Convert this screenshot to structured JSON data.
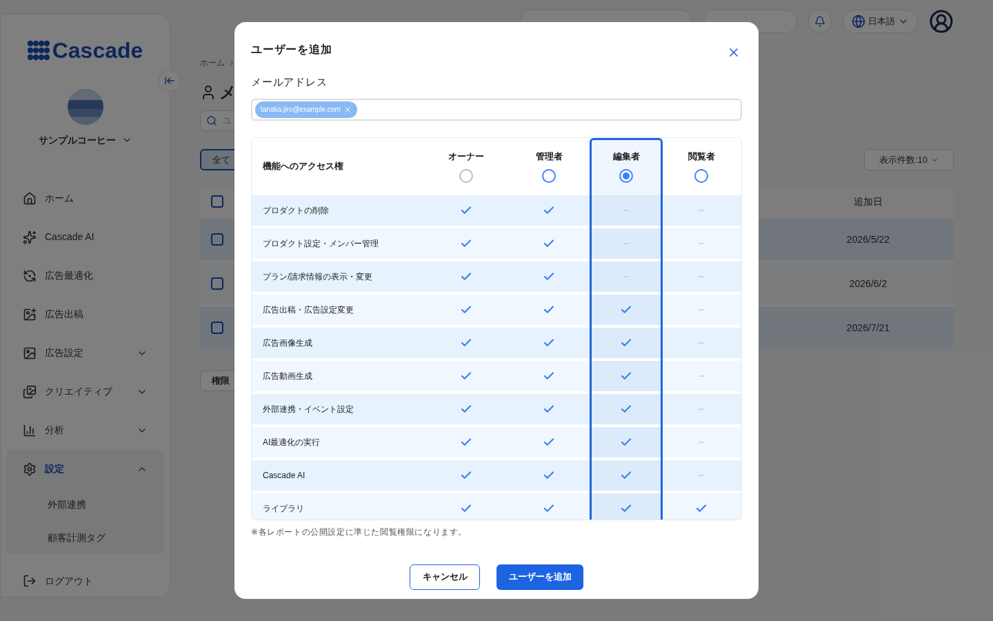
{
  "sidebar": {
    "logo": "Cascade",
    "company": "サンプルコーヒー",
    "items": [
      {
        "label": "ホーム",
        "kind": "link",
        "selected": false
      },
      {
        "label": "Cascade AI",
        "kind": "link",
        "selected": false
      },
      {
        "label": "広告最適化",
        "kind": "link",
        "selected": false
      },
      {
        "label": "広告出稿",
        "kind": "link",
        "selected": false
      },
      {
        "label": "広告設定",
        "kind": "group",
        "expanded": false,
        "selected": false
      },
      {
        "label": "クリエイティブ",
        "kind": "group",
        "expanded": false,
        "selected": false
      },
      {
        "label": "分析",
        "kind": "group",
        "expanded": false,
        "selected": false
      },
      {
        "label": "設定",
        "kind": "group",
        "expanded": true,
        "selected": true,
        "children": [
          {
            "label": "外部連携"
          },
          {
            "label": "顧客計測タグ"
          }
        ]
      }
    ],
    "logout": "ログアウト"
  },
  "topbar": {
    "language": "日本語"
  },
  "page": {
    "breadcrumb": "ホーム",
    "title_fragment": "メ",
    "search_fragment": "ユ",
    "filter_fragment": "全て",
    "page_size": "表示件数:10",
    "header_checked": false,
    "date_header": "追加日",
    "rows": [
      {
        "date": "2026/5/22",
        "checked": false
      },
      {
        "date": "2026/6/2",
        "checked": false
      },
      {
        "date": "2026/7/21",
        "checked": false
      }
    ],
    "permission_fragment": "権限"
  },
  "dialog": {
    "title": "ユーザーを追加",
    "email_label": "メールアドレス",
    "emails": [
      "tanaka.jiro@example.com"
    ],
    "access_header": "機能へのアクセス権",
    "roles": [
      {
        "label": "オーナー",
        "selected": false,
        "disabled": true
      },
      {
        "label": "管理者",
        "selected": false,
        "disabled": false
      },
      {
        "label": "編集者",
        "selected": true,
        "disabled": false
      },
      {
        "label": "閲覧者",
        "selected": false,
        "disabled": false
      }
    ],
    "features": [
      {
        "label": "プロダクトの削除",
        "access": [
          true,
          true,
          false,
          false
        ]
      },
      {
        "label": "プロダクト設定・メンバー管理",
        "access": [
          true,
          true,
          false,
          false
        ]
      },
      {
        "label": "プラン/請求情報の表示・変更",
        "access": [
          true,
          true,
          false,
          false
        ]
      },
      {
        "label": "広告出稿・広告設定変更",
        "access": [
          true,
          true,
          true,
          false
        ]
      },
      {
        "label": "広告画像生成",
        "access": [
          true,
          true,
          true,
          false
        ]
      },
      {
        "label": "広告動画生成",
        "access": [
          true,
          true,
          true,
          false
        ]
      },
      {
        "label": "外部連携・イベント設定",
        "access": [
          true,
          true,
          true,
          false
        ]
      },
      {
        "label": "AI最適化の実行",
        "access": [
          true,
          true,
          true,
          false
        ]
      },
      {
        "label": "Cascade AI",
        "access": [
          true,
          true,
          true,
          false
        ]
      },
      {
        "label": "ライブラリ",
        "access": [
          true,
          true,
          true,
          true
        ]
      }
    ],
    "note": "※各レポートの公開設定に準じた閲覧権限になります。",
    "cancel": "キャンセル",
    "submit": "ユーザーを追加"
  }
}
